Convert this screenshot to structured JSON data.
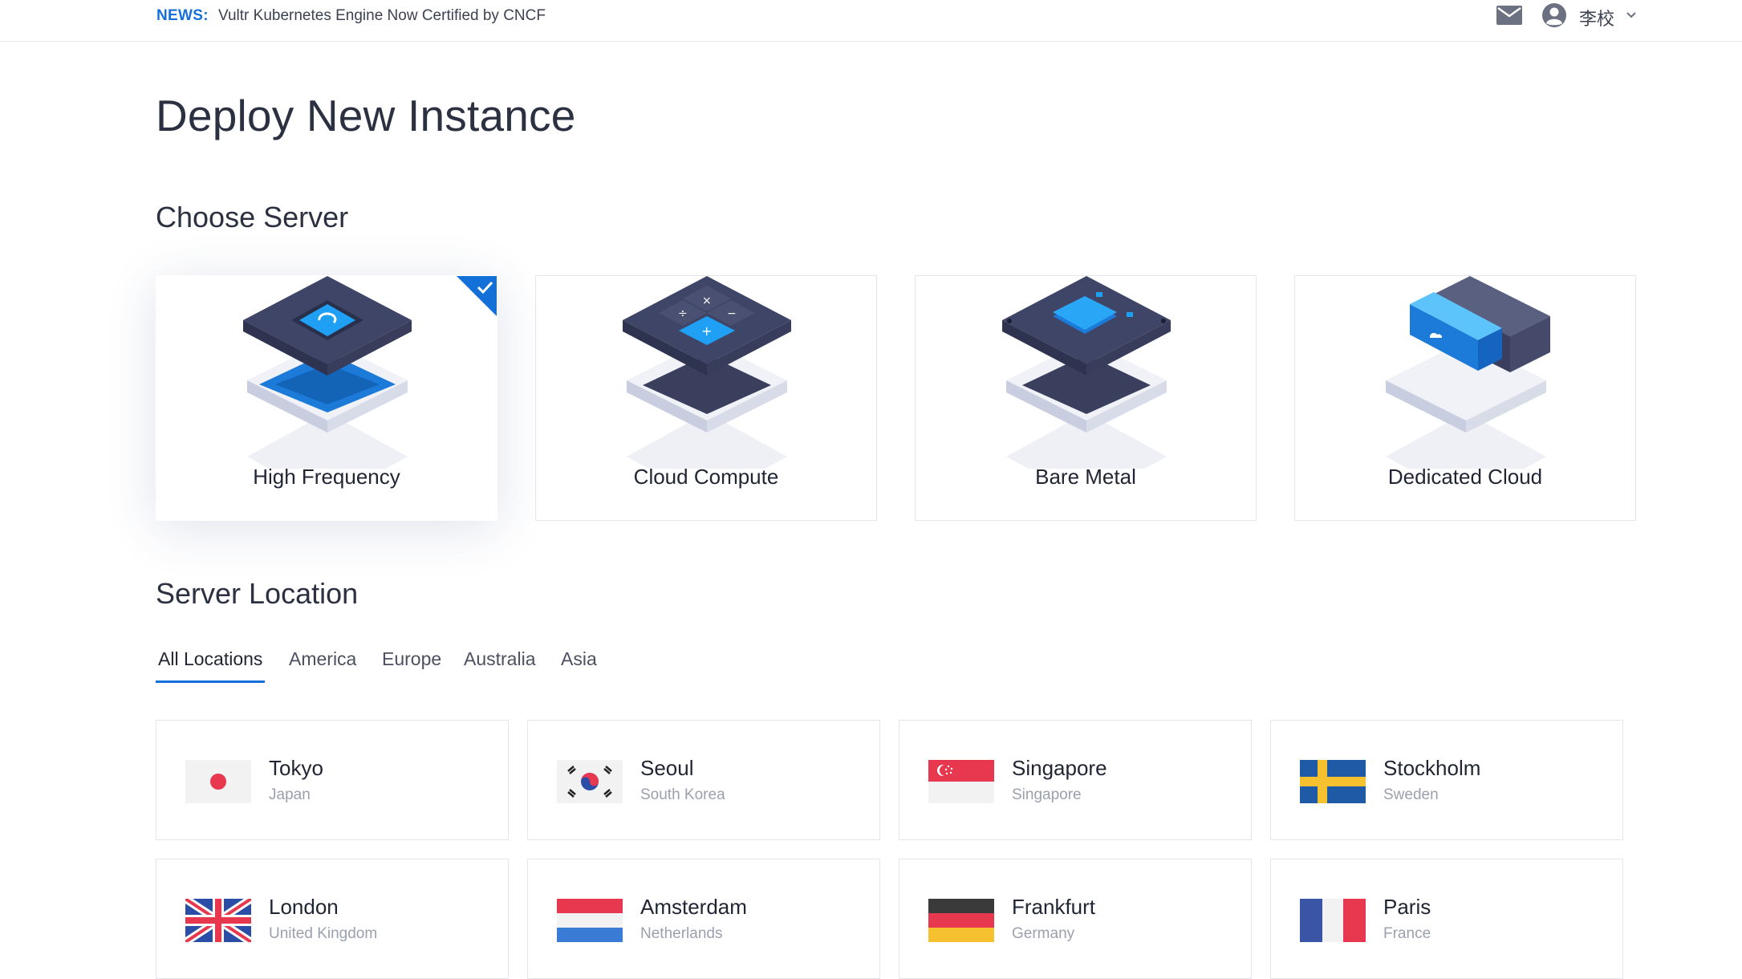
{
  "news": {
    "label": "NEWS:",
    "text": "Vultr Kubernetes Engine Now Certified by CNCF"
  },
  "header": {
    "user_name": "李校",
    "icons": [
      "mail-icon",
      "user-avatar-icon",
      "chevron-down-icon"
    ]
  },
  "page_title": "Deploy New Instance",
  "choose_server": {
    "title": "Choose Server",
    "options": [
      {
        "label": "High Frequency",
        "selected": true,
        "icon": "high-frequency-icon"
      },
      {
        "label": "Cloud Compute",
        "selected": false,
        "icon": "cloud-compute-icon"
      },
      {
        "label": "Bare Metal",
        "selected": false,
        "icon": "bare-metal-icon"
      },
      {
        "label": "Dedicated Cloud",
        "selected": false,
        "icon": "dedicated-cloud-icon"
      }
    ]
  },
  "server_location": {
    "title": "Server Location",
    "tabs": [
      {
        "label": "All Locations",
        "active": true
      },
      {
        "label": "America",
        "active": false
      },
      {
        "label": "Europe",
        "active": false
      },
      {
        "label": "Australia",
        "active": false
      },
      {
        "label": "Asia",
        "active": false
      }
    ],
    "locations": [
      {
        "city": "Tokyo",
        "country": "Japan",
        "flag": "flag-japan-icon"
      },
      {
        "city": "Seoul",
        "country": "South Korea",
        "flag": "flag-south-korea-icon"
      },
      {
        "city": "Singapore",
        "country": "Singapore",
        "flag": "flag-singapore-icon"
      },
      {
        "city": "Stockholm",
        "country": "Sweden",
        "flag": "flag-sweden-icon"
      },
      {
        "city": "London",
        "country": "United Kingdom",
        "flag": "flag-uk-icon"
      },
      {
        "city": "Amsterdam",
        "country": "Netherlands",
        "flag": "flag-netherlands-icon"
      },
      {
        "city": "Frankfurt",
        "country": "Germany",
        "flag": "flag-germany-icon"
      },
      {
        "city": "Paris",
        "country": "France",
        "flag": "flag-france-icon"
      }
    ]
  },
  "colors": {
    "accent": "#1470d9",
    "text": "#1f2533",
    "muted": "#9aa0ae",
    "border": "#e3e6ec"
  }
}
